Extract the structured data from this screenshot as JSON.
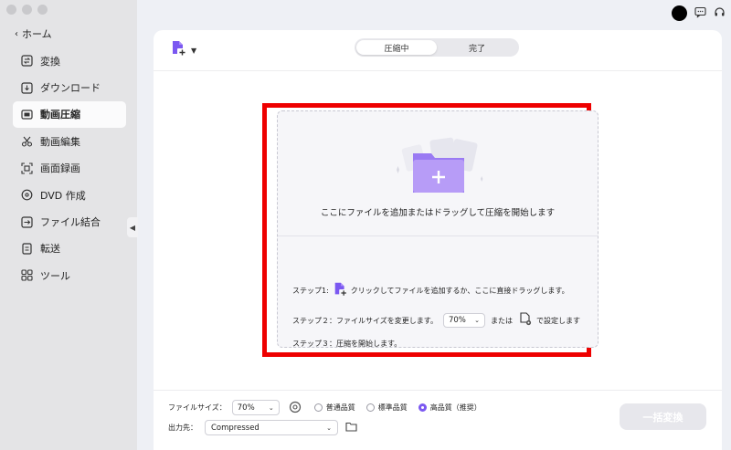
{
  "sidebar": {
    "home_label": "ホーム",
    "items": [
      {
        "label": "変換",
        "icon": "convert-icon"
      },
      {
        "label": "ダウンロード",
        "icon": "download-icon"
      },
      {
        "label": "動画圧縮",
        "icon": "compress-icon",
        "active": true
      },
      {
        "label": "動画編集",
        "icon": "scissors-icon"
      },
      {
        "label": "画面録画",
        "icon": "screen-record-icon"
      },
      {
        "label": "DVD 作成",
        "icon": "dvd-icon"
      },
      {
        "label": "ファイル結合",
        "icon": "merge-icon"
      },
      {
        "label": "転送",
        "icon": "transfer-icon"
      },
      {
        "label": "ツール",
        "icon": "tools-icon"
      }
    ]
  },
  "tabs": {
    "compressing": "圧縮中",
    "done": "完了"
  },
  "dropzone": {
    "main_text": "ここにファイルを追加またはドラッグして圧縮を開始します",
    "step1_prefix": "ステップ1:",
    "step1_text": "クリックしてファイルを追加するか、ここに直接ドラッグします。",
    "step2_text": "ステップ２：ファイルサイズを変更します。",
    "step2_value": "70%",
    "step2_or": "または",
    "step2_suffix": "で設定します",
    "step3_text": "ステップ３：圧縮を開始します。"
  },
  "footer": {
    "filesize_label": "ファイルサイズ：",
    "filesize_value": "70%",
    "quality_options": [
      "普通品質",
      "標準品質",
      "高品質（推奨）"
    ],
    "quality_selected": "高品質（推奨）",
    "output_label": "出力先：",
    "output_value": "Compressed",
    "convert_all": "一括変換"
  },
  "colors": {
    "accent": "#7b58f1",
    "highlight_box": "#ee0000"
  }
}
